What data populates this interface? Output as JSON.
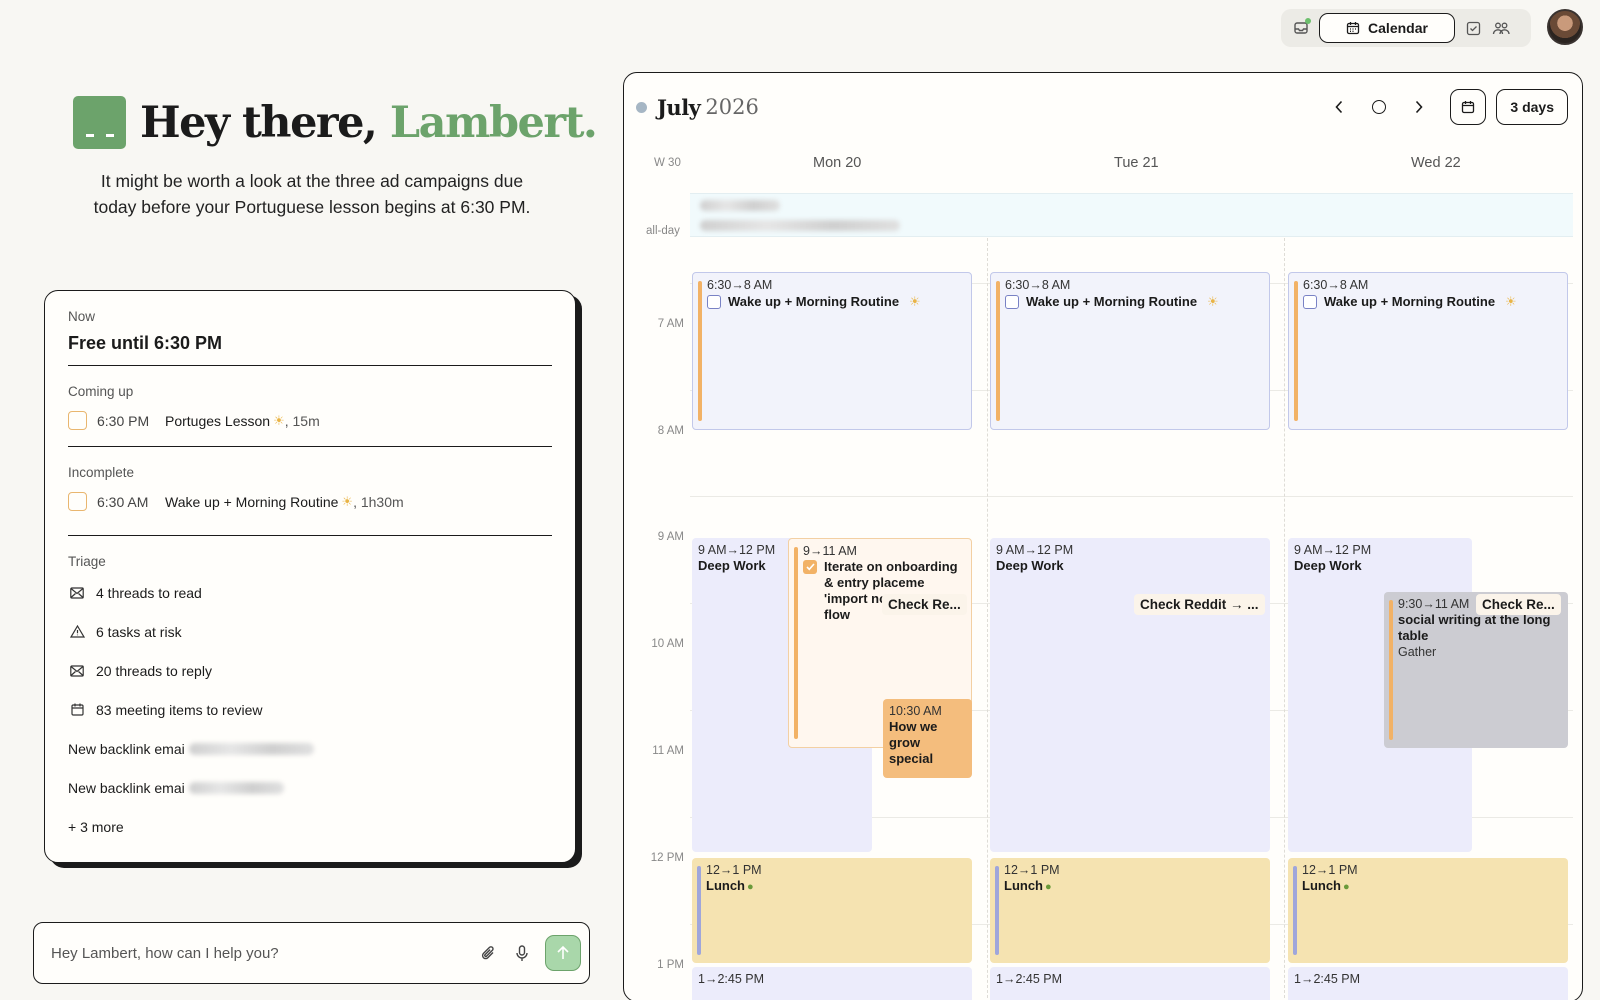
{
  "toolbar": {
    "calendar_label": "Calendar"
  },
  "greeting": {
    "hello": "Hey there, ",
    "name": "Lambert."
  },
  "subtitle": "It might be worth a look at the three ad campaigns due today before your Portuguese lesson begins at 6:30 PM.",
  "card": {
    "now_label": "Now",
    "now_title": "Free until 6:30 PM",
    "coming_label": "Coming up",
    "coming": {
      "time": "6:30 PM",
      "title": "Portuges Lesson",
      "duration": ", 15m"
    },
    "incomplete_label": "Incomplete",
    "incomplete": {
      "time": "6:30 AM",
      "title": "Wake up + Morning Routine",
      "duration": ", 1h30m"
    },
    "triage_label": "Triage",
    "triage": [
      {
        "text": "4 threads to read",
        "icon": "mail-icon"
      },
      {
        "text": "6 tasks at risk",
        "icon": "warning-icon"
      },
      {
        "text": "20 threads to reply",
        "icon": "mail-icon"
      },
      {
        "text": "83 meeting items to review",
        "icon": "calendar-icon"
      }
    ],
    "backlinks": [
      "New backlink emai",
      "New backlink emai"
    ],
    "more": "+ 3 more"
  },
  "chat": {
    "placeholder": "Hey Lambert, how can I help you?"
  },
  "calendar": {
    "month": "July",
    "year": "2026",
    "view_label": "3 days",
    "week": "W 30",
    "allday": "all-day",
    "days": [
      "Mon 20",
      "Tue 21",
      "Wed 22"
    ],
    "hours": [
      "7 AM",
      "8 AM",
      "9 AM",
      "10 AM",
      "11 AM",
      "12 PM",
      "1 PM"
    ],
    "events": {
      "morning_time": "6:30→8 AM",
      "morning_title": "Wake up + Morning Routine",
      "deep_time": "9 AM→12 PM",
      "deep_title": "Deep Work",
      "iter_time": "9→11 AM",
      "iter_title": "Iterate on onboarding & entry placeme 'import notes' CTA flow",
      "check_reddit_short": "Check Re...",
      "check_reddit_arrow": "Check Reddit → ...",
      "grow_time": "10:30 AM",
      "grow_title": "How we grow special",
      "social_time": "9:30→11 AM",
      "social_title": "social writing at the long table",
      "social_sub": "Gather",
      "lunch_time": "12→1 PM",
      "lunch_title": "Lunch",
      "next_time": "1→2:45 PM"
    }
  },
  "colors": {
    "accent_green": "#6ca36b",
    "event_orange": "#f2b266",
    "lunch_yellow": "#f5e3b1",
    "deep_work_lavender": "#ececfb"
  }
}
